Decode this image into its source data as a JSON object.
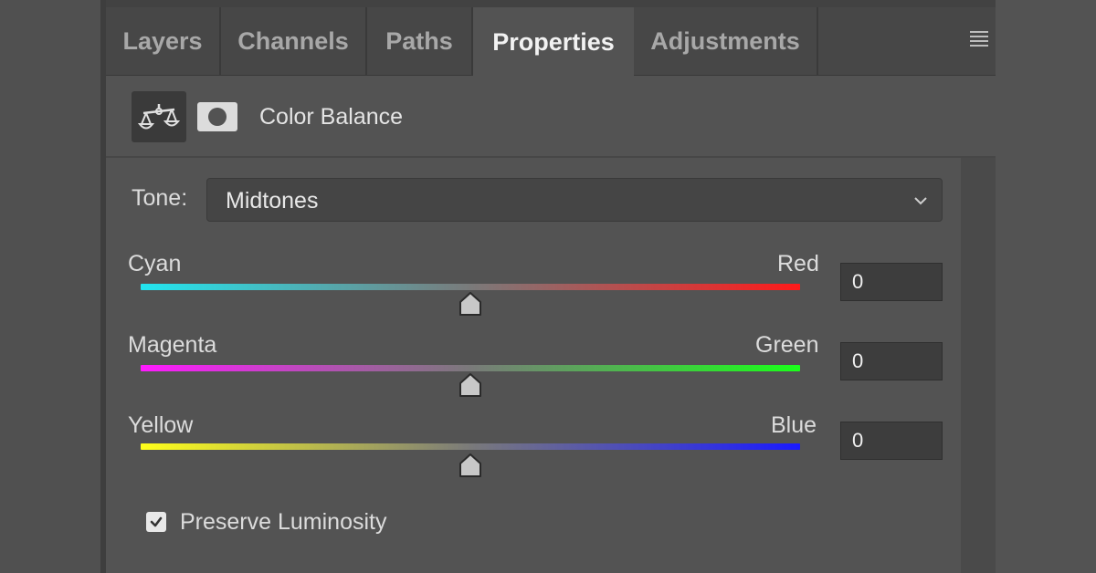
{
  "tabs": [
    {
      "label": "Layers",
      "active": false
    },
    {
      "label": "Channels",
      "active": false
    },
    {
      "label": "Paths",
      "active": false
    },
    {
      "label": "Properties",
      "active": true
    },
    {
      "label": "Adjustments",
      "active": false
    }
  ],
  "header": {
    "title": "Color Balance",
    "icons": [
      "balance-scale-icon",
      "layer-mask-icon"
    ]
  },
  "tone": {
    "label": "Tone:",
    "selected": "Midtones"
  },
  "sliders": [
    {
      "left_label": "Cyan",
      "right_label": "Red",
      "value": "0",
      "from_color": "#22e6f0",
      "to_color": "#ff1a1a"
    },
    {
      "left_label": "Magenta",
      "right_label": "Green",
      "value": "0",
      "from_color": "#ff1aff",
      "to_color": "#1aff1a"
    },
    {
      "left_label": "Yellow",
      "right_label": "Blue",
      "value": "0",
      "from_color": "#ffff1a",
      "to_color": "#1a1aff"
    }
  ],
  "preserve_luminosity": {
    "label": "Preserve Luminosity",
    "checked": true
  }
}
